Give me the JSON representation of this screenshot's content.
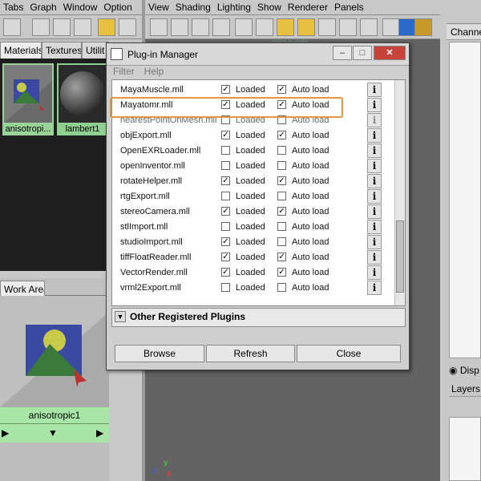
{
  "left_menubar": {
    "items": [
      "Tabs",
      "Graph",
      "Window",
      "Option"
    ]
  },
  "left_tabs": [
    "Materials",
    "Textures",
    "Utilit"
  ],
  "swatches": [
    {
      "label": "anisotropi..."
    },
    {
      "label": "lambert1"
    }
  ],
  "work_area": {
    "tab_label": "Work Area",
    "swatch_label": "anisotropic1"
  },
  "viewport": {
    "menubar": [
      "View",
      "Shading",
      "Lighting",
      "Show",
      "Renderer",
      "Panels"
    ],
    "resolution": "640 x 480"
  },
  "right_panel": {
    "channel_tab": "Channe",
    "disp_label": "Disp",
    "layers_label": "Layers"
  },
  "dialog": {
    "title": "Plug-in Manager",
    "menu": [
      "Filter",
      "Help"
    ],
    "loaded_label": "Loaded",
    "autoload_label": "Auto load",
    "plugins": [
      {
        "name": "MayaMuscle.mll",
        "loaded": true,
        "autoload": true,
        "dim": false
      },
      {
        "name": "Mayatomr.mll",
        "loaded": true,
        "autoload": true,
        "dim": false
      },
      {
        "name": "nearestPointOnMesh.mll",
        "loaded": false,
        "autoload": false,
        "dim": true
      },
      {
        "name": "objExport.mll",
        "loaded": true,
        "autoload": true,
        "dim": false
      },
      {
        "name": "OpenEXRLoader.mll",
        "loaded": false,
        "autoload": false,
        "dim": false
      },
      {
        "name": "openInventor.mll",
        "loaded": false,
        "autoload": false,
        "dim": false
      },
      {
        "name": "rotateHelper.mll",
        "loaded": true,
        "autoload": true,
        "dim": false
      },
      {
        "name": "rtgExport.mll",
        "loaded": false,
        "autoload": false,
        "dim": false
      },
      {
        "name": "stereoCamera.mll",
        "loaded": true,
        "autoload": true,
        "dim": false
      },
      {
        "name": "stlImport.mll",
        "loaded": false,
        "autoload": false,
        "dim": false
      },
      {
        "name": "studioImport.mll",
        "loaded": true,
        "autoload": false,
        "dim": false
      },
      {
        "name": "tiffFloatReader.mll",
        "loaded": true,
        "autoload": true,
        "dim": false
      },
      {
        "name": "VectorRender.mll",
        "loaded": true,
        "autoload": true,
        "dim": false
      },
      {
        "name": "vrml2Export.mll",
        "loaded": false,
        "autoload": false,
        "dim": false
      }
    ],
    "other_section": "Other Registered Plugins",
    "buttons": {
      "browse": "Browse",
      "refresh": "Refresh",
      "close": "Close"
    }
  },
  "colors": {
    "highlight": "#e09a3a",
    "swatch_bg": "#9ad39a",
    "viewport_bg": "#636363"
  },
  "axis_labels": {
    "y": "y",
    "z": "z",
    "x": "x"
  }
}
